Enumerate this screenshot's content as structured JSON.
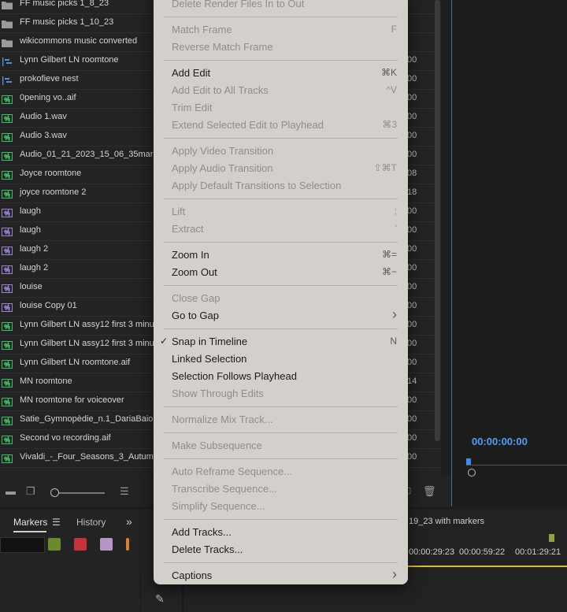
{
  "project_panel": {
    "items": [
      {
        "name": "FF music picks 1_8_23",
        "icon": "folder-icon",
        "duration": ""
      },
      {
        "name": "FF music picks 1_10_23",
        "icon": "folder-icon",
        "duration": ""
      },
      {
        "name": "wikicommons music converted",
        "icon": "folder-icon",
        "duration": ""
      },
      {
        "name": "Lynn Gilbert LN roomtone",
        "icon": "sequence-icon",
        "duration": "00"
      },
      {
        "name": "prokofieve nest",
        "icon": "sequence-icon",
        "duration": "00"
      },
      {
        "name": "0pening vo..aif",
        "icon": "audio-clip-icon",
        "duration": "00"
      },
      {
        "name": "Audio 1.wav",
        "icon": "audio-clip-icon",
        "duration": "00"
      },
      {
        "name": "Audio 3.wav",
        "icon": "audio-clip-icon",
        "duration": "00"
      },
      {
        "name": "Audio_01_21_2023_15_06_35mar",
        "icon": "audio-clip-icon",
        "duration": "00"
      },
      {
        "name": "Joyce roomtone",
        "icon": "audio-clip-icon",
        "duration": "08"
      },
      {
        "name": "joyce roomtone 2",
        "icon": "audio-clip-icon",
        "duration": "18"
      },
      {
        "name": "laugh",
        "icon": "subclip-icon",
        "duration": "00"
      },
      {
        "name": "laugh",
        "icon": "subclip-icon",
        "duration": "00"
      },
      {
        "name": "laugh 2",
        "icon": "subclip-icon",
        "duration": "00"
      },
      {
        "name": "laugh 2",
        "icon": "subclip-icon",
        "duration": "00"
      },
      {
        "name": "louise",
        "icon": "subclip-icon",
        "duration": "00"
      },
      {
        "name": "louise Copy 01",
        "icon": "subclip-icon",
        "duration": "00"
      },
      {
        "name": "Lynn Gilbert LN assy12 first 3 minu",
        "icon": "audio-clip-icon",
        "duration": "00"
      },
      {
        "name": "Lynn Gilbert LN assy12 first 3 minu",
        "icon": "audio-clip-icon",
        "duration": "00"
      },
      {
        "name": "Lynn Gilbert LN roomtone.aif",
        "icon": "audio-clip-icon",
        "duration": "00"
      },
      {
        "name": "MN roomtone",
        "icon": "audio-clip-icon",
        "duration": "14"
      },
      {
        "name": "MN roomtone for voiceover",
        "icon": "audio-clip-icon",
        "duration": "00"
      },
      {
        "name": "Satie_Gymnopèdie_n.1_DariaBaio",
        "icon": "audio-clip-icon",
        "duration": "00"
      },
      {
        "name": "Second vo recording.aif",
        "icon": "audio-clip-icon",
        "duration": "00"
      },
      {
        "name": "Vivaldi_-_Four_Seasons_3_Autum",
        "icon": "audio-clip-icon",
        "duration": "00"
      }
    ]
  },
  "monitor": {
    "timecode": "00:00:00:00"
  },
  "bottom_panels": {
    "markers_tab": "Markers",
    "history_tab": "History",
    "markers_menu_glyph": "☰",
    "more_glyph": "»",
    "marker_colors": [
      "#6b8a2f",
      "#c8323a",
      "#b894c8",
      "#d9822b"
    ]
  },
  "timeline": {
    "sequence_name": "19_23 with markers",
    "timecodes": [
      "00:00:29:23",
      "00:00:59:22",
      "00:01:29:21"
    ]
  },
  "context_menu": {
    "items": [
      {
        "label": "Delete Render Files In to Out",
        "shortcut": "",
        "enabled": false
      },
      "sep",
      {
        "label": "Match Frame",
        "shortcut": "F",
        "enabled": false
      },
      {
        "label": "Reverse Match Frame",
        "shortcut": "",
        "enabled": false
      },
      "sep",
      {
        "label": "Add Edit",
        "shortcut": "⌘K",
        "enabled": true
      },
      {
        "label": "Add Edit to All Tracks",
        "shortcut": "^V",
        "enabled": false
      },
      {
        "label": "Trim Edit",
        "shortcut": "",
        "enabled": false
      },
      {
        "label": "Extend Selected Edit to Playhead",
        "shortcut": "⌘3",
        "enabled": false
      },
      "sep",
      {
        "label": "Apply Video Transition",
        "shortcut": "",
        "enabled": false
      },
      {
        "label": "Apply Audio Transition",
        "shortcut": "⇧⌘T",
        "enabled": false
      },
      {
        "label": "Apply Default Transitions to Selection",
        "shortcut": "",
        "enabled": false
      },
      "sep",
      {
        "label": "Lift",
        "shortcut": ";",
        "enabled": false
      },
      {
        "label": "Extract",
        "shortcut": "'",
        "enabled": false
      },
      "sep",
      {
        "label": "Zoom In",
        "shortcut": "⌘=",
        "enabled": true
      },
      {
        "label": "Zoom Out",
        "shortcut": "⌘−",
        "enabled": true
      },
      "sep",
      {
        "label": "Close Gap",
        "shortcut": "",
        "enabled": false
      },
      {
        "label": "Go to Gap",
        "shortcut": "›",
        "enabled": true
      },
      "sep",
      {
        "label": "Snap in Timeline",
        "shortcut": "N",
        "enabled": true,
        "checked": true
      },
      {
        "label": "Linked Selection",
        "shortcut": "",
        "enabled": true
      },
      {
        "label": "Selection Follows Playhead",
        "shortcut": "",
        "enabled": true
      },
      {
        "label": "Show Through Edits",
        "shortcut": "",
        "enabled": false
      },
      "sep",
      {
        "label": "Normalize Mix Track...",
        "shortcut": "",
        "enabled": false
      },
      "sep",
      {
        "label": "Make Subsequence",
        "shortcut": "",
        "enabled": false
      },
      "sep",
      {
        "label": "Auto Reframe Sequence...",
        "shortcut": "",
        "enabled": false
      },
      {
        "label": "Transcribe Sequence...",
        "shortcut": "",
        "enabled": false
      },
      {
        "label": "Simplify Sequence...",
        "shortcut": "",
        "enabled": false
      },
      "sep",
      {
        "label": "Add Tracks...",
        "shortcut": "",
        "enabled": true
      },
      {
        "label": "Delete Tracks...",
        "shortcut": "",
        "enabled": true
      },
      "sep",
      {
        "label": "Captions",
        "shortcut": "›",
        "enabled": true
      }
    ]
  }
}
